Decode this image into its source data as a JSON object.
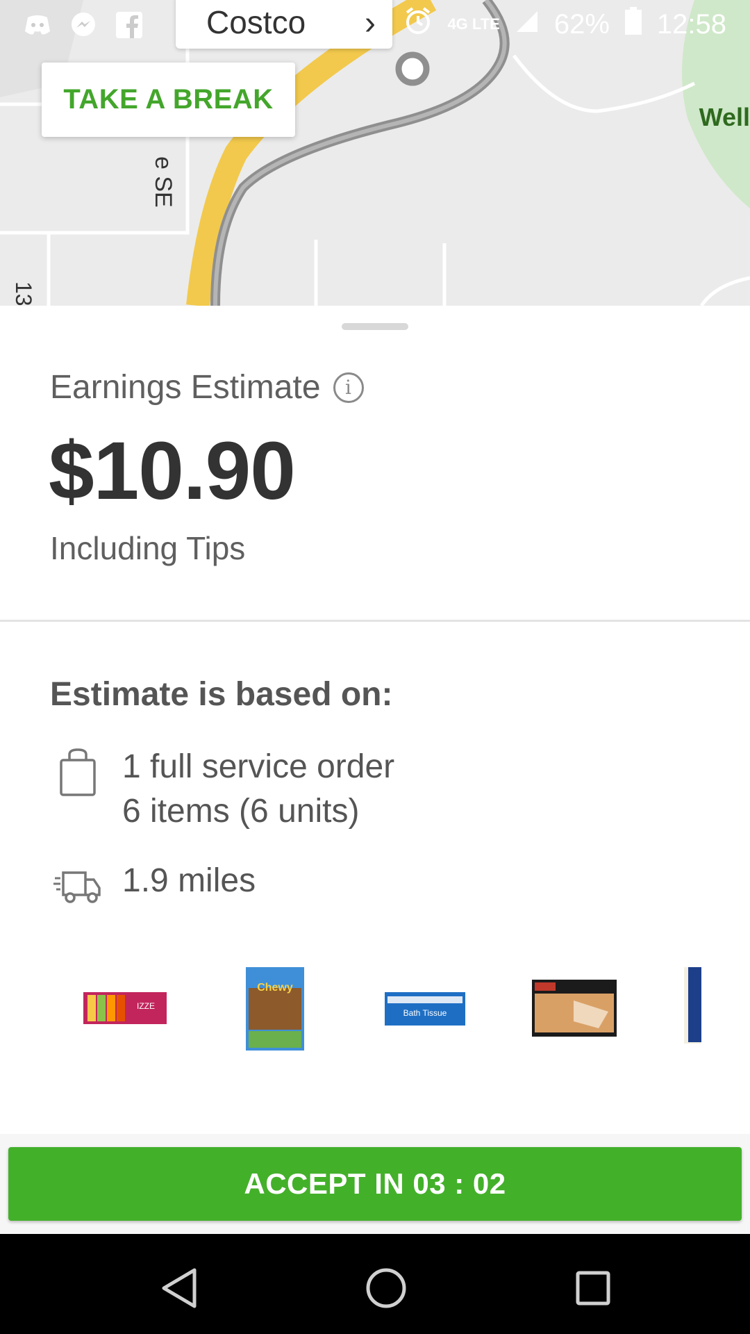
{
  "status_bar": {
    "battery": "62%",
    "time": "12:58",
    "network": "4G LTE",
    "icons": [
      "discord-icon",
      "messenger-icon",
      "facebook-icon",
      "alarm-icon",
      "signal-icon",
      "battery-icon"
    ]
  },
  "map": {
    "destination": "Costco",
    "take_break_label": "TAKE A BREAK",
    "road_labels": [
      "e SE",
      "13"
    ],
    "place_label": "Well",
    "colors": {
      "route": "#9b9b9b",
      "highway": "#f2c94c",
      "park": "#cfe8c9"
    }
  },
  "earnings": {
    "label": "Earnings Estimate",
    "amount": "$10.90",
    "subtitle": "Including Tips"
  },
  "estimate": {
    "heading": "Estimate is based on:",
    "order_line1": "1 full service order",
    "order_line2": "6 items (6 units)",
    "distance": "1.9 miles"
  },
  "products": [
    {
      "name": "izze-icon",
      "label": "IZZE"
    },
    {
      "name": "chewy-bars-icon",
      "label": "Chewy"
    },
    {
      "name": "bath-tissue-icon",
      "label": "Bath Tissue"
    },
    {
      "name": "chicken-noodle-meal-icon"
    },
    {
      "name": "partial-product-icon"
    }
  ],
  "accept": {
    "label": "ACCEPT IN 03 : 02",
    "color": "#43b02a"
  },
  "brand_color": "#43a62b"
}
